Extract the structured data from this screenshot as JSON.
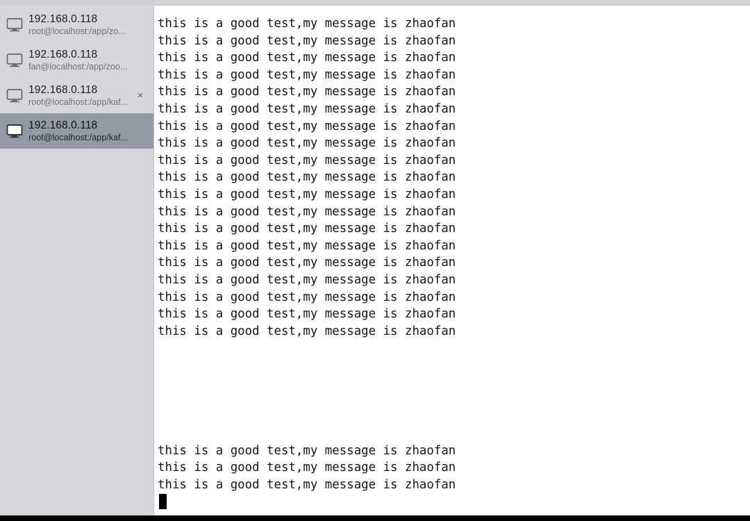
{
  "window": {
    "title": "192.168.0.118",
    "titlebar_color": "#d2d4d8",
    "sidebar_color": "#d6d7db",
    "selected_color": "#939aa5",
    "terminal_bg": "#ffffff",
    "terminal_fg": "#15161a"
  },
  "sidebar": {
    "sessions": [
      {
        "host": "192.168.0.118",
        "path": "root@localhost:/app/zo...",
        "icon": "monitor-icon",
        "selected": false,
        "close_label": "×",
        "show_close": false
      },
      {
        "host": "192.168.0.118",
        "path": "fan@localhost:/app/zoo...",
        "icon": "monitor-icon",
        "selected": false,
        "close_label": "×",
        "show_close": false
      },
      {
        "host": "192.168.0.118",
        "path": "root@localhost:/app/kaf...",
        "icon": "monitor-icon",
        "selected": false,
        "close_label": "×",
        "show_close": true
      },
      {
        "host": "192.168.0.118",
        "path": "root@localhost:/app/kaf...",
        "icon": "monitor-icon",
        "selected": true,
        "close_label": "×",
        "show_close": false
      }
    ]
  },
  "terminal": {
    "message": "this is a good test,my message is zhaofan",
    "cursor": "block",
    "lines": [
      "this is a good test,my message is zhaofan",
      "this is a good test,my message is zhaofan",
      "this is a good test,my message is zhaofan",
      "this is a good test,my message is zhaofan",
      "this is a good test,my message is zhaofan",
      "this is a good test,my message is zhaofan",
      "this is a good test,my message is zhaofan",
      "this is a good test,my message is zhaofan",
      "this is a good test,my message is zhaofan",
      "this is a good test,my message is zhaofan",
      "this is a good test,my message is zhaofan",
      "this is a good test,my message is zhaofan",
      "this is a good test,my message is zhaofan",
      "this is a good test,my message is zhaofan",
      "this is a good test,my message is zhaofan",
      "this is a good test,my message is zhaofan",
      "this is a good test,my message is zhaofan",
      "this is a good test,my message is zhaofan",
      "this is a good test,my message is zhaofan",
      "",
      "",
      "",
      "",
      "",
      "",
      "this is a good test,my message is zhaofan",
      "this is a good test,my message is zhaofan",
      "this is a good test,my message is zhaofan"
    ]
  }
}
